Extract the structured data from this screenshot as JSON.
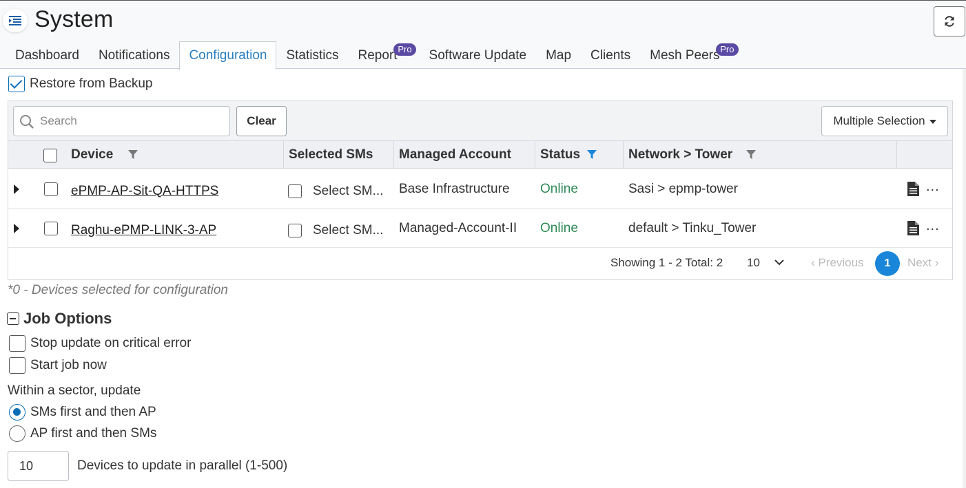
{
  "header": {
    "title": "System",
    "menu_icon": "list-indent-icon",
    "refresh_icon": "refresh-icon"
  },
  "tabs": [
    {
      "label": "Dashboard",
      "active": false,
      "badge": ""
    },
    {
      "label": "Notifications",
      "active": false,
      "badge": ""
    },
    {
      "label": "Configuration",
      "active": true,
      "badge": ""
    },
    {
      "label": "Statistics",
      "active": false,
      "badge": ""
    },
    {
      "label": "Report",
      "active": false,
      "badge": "Pro"
    },
    {
      "label": "Software Update",
      "active": false,
      "badge": ""
    },
    {
      "label": "Map",
      "active": false,
      "badge": ""
    },
    {
      "label": "Clients",
      "active": false,
      "badge": ""
    },
    {
      "label": "Mesh Peers",
      "active": false,
      "badge": "Pro"
    }
  ],
  "restore": {
    "label": "Restore from Backup",
    "checked": true
  },
  "toolbar": {
    "search_placeholder": "Search",
    "search_value": "",
    "clear_label": "Clear",
    "multi_label": "Multiple Selection"
  },
  "table": {
    "columns": [
      "Device",
      "Selected SMs",
      "Managed Account",
      "Status",
      "Network > Tower"
    ],
    "rows": [
      {
        "device": "ePMP-AP-Sit-QA-HTTPS",
        "sms": "Select SM...",
        "account": "Base Infrastructure",
        "status": "Online",
        "network": "Sasi > epmp-tower",
        "more": "..."
      },
      {
        "device": "Raghu-ePMP-LINK-3-AP",
        "sms": "Select SM...",
        "account": "Managed-Account-II",
        "status": "Online",
        "network": "default > Tinku_Tower",
        "more": "..."
      }
    ]
  },
  "pagination": {
    "showing": "Showing 1 - 2 Total: 2",
    "page_size": "10",
    "previous": "Previous",
    "current_page": "1",
    "next": "Next"
  },
  "selected_note": "*0 - Devices selected for configuration",
  "job_options": {
    "title": "Job Options",
    "stop_on_error": "Stop update on critical error",
    "start_now": "Start job now",
    "sector_label": "Within a sector, update",
    "radio_sms_first": "SMs first and then AP",
    "radio_ap_first": "AP first and then SMs",
    "parallel_value": "10",
    "parallel_label": "Devices to update in parallel (1-500)"
  },
  "colors": {
    "accent": "#2a7fc1",
    "online": "#2e8b57",
    "pro_badge": "#5b4aa4",
    "page_active": "#1a86d9"
  }
}
